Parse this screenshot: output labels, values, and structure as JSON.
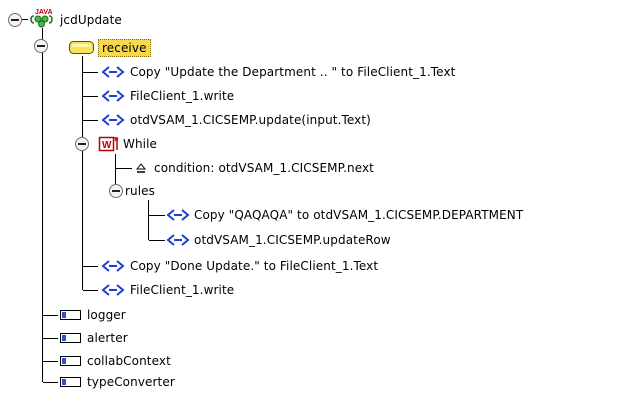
{
  "tree": {
    "root": {
      "label": "jcdUpdate",
      "badge": "JAVA",
      "icon": "java-collab-icon"
    },
    "receive": {
      "label": "receive",
      "icon": "method-folder-icon",
      "selected": true
    },
    "rows": [
      {
        "label": "Copy \"Update the Department .. \" to FileClient_1.Text",
        "icon": "code-statement-icon"
      },
      {
        "label": "FileClient_1.write",
        "icon": "code-statement-icon"
      },
      {
        "label": "otdVSAM_1.CICSEMP.update(input.Text)",
        "icon": "code-statement-icon"
      },
      {
        "label": "While",
        "icon": "while-loop-icon"
      },
      {
        "label": "condition: otdVSAM_1.CICSEMP.next",
        "icon": "condition-icon"
      },
      {
        "label": "rules",
        "icon": "none"
      },
      {
        "label": "Copy \"QAQAQA\" to otdVSAM_1.CICSEMP.DEPARTMENT",
        "icon": "code-statement-icon"
      },
      {
        "label": "otdVSAM_1.CICSEMP.updateRow",
        "icon": "code-statement-icon"
      },
      {
        "label": "Copy \"Done Update.\" to FileClient_1.Text",
        "icon": "code-statement-icon"
      },
      {
        "label": "FileClient_1.write",
        "icon": "code-statement-icon"
      }
    ],
    "fields": [
      {
        "label": "logger",
        "icon": "field-icon"
      },
      {
        "label": "alerter",
        "icon": "field-icon"
      },
      {
        "label": "collabContext",
        "icon": "field-icon"
      },
      {
        "label": "typeConverter",
        "icon": "field-icon"
      }
    ]
  }
}
